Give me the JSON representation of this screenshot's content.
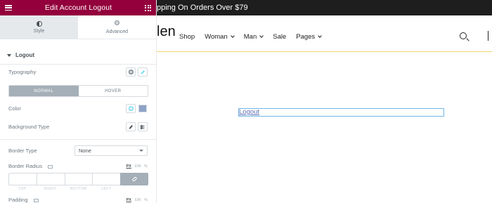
{
  "panel": {
    "title": "Edit Account Logout",
    "tabs": [
      {
        "label": "Style",
        "icon": "half-circle-icon",
        "active": true
      },
      {
        "label": "Advanced",
        "icon": "gear-icon",
        "active": false
      }
    ],
    "section": "Logout",
    "typography_label": "Typography",
    "state_toggle": {
      "normal": "NORMAL",
      "hover": "HOVER",
      "selected": "NORMAL"
    },
    "color_label": "Color",
    "color_value": "#8fa3c7",
    "bg_type_label": "Background Type",
    "border_type_label": "Border Type",
    "border_type_value": "None",
    "border_radius_label": "Border Radius",
    "units": [
      "PX",
      "EM",
      "%"
    ],
    "dim_labels": [
      "TOP",
      "RIGHT",
      "BOTTOM",
      "LEFT"
    ],
    "padding_label": "Padding"
  },
  "preview": {
    "announcement": "pping On Orders Over $79",
    "logo_fragment": "len",
    "menu": [
      {
        "label": "Shop",
        "dropdown": false
      },
      {
        "label": "Woman",
        "dropdown": true
      },
      {
        "label": "Man",
        "dropdown": true
      },
      {
        "label": "Sale",
        "dropdown": false
      },
      {
        "label": "Pages",
        "dropdown": true
      }
    ],
    "logout_link": "Logout"
  },
  "colors": {
    "header_bg": "#93003c",
    "accent": "#71d7f7",
    "toggle_active": "#a4afb7",
    "announcement_bg": "#1e1e1e",
    "navbar_border": "#f2d36b",
    "widget_outline": "#71b7e6"
  }
}
